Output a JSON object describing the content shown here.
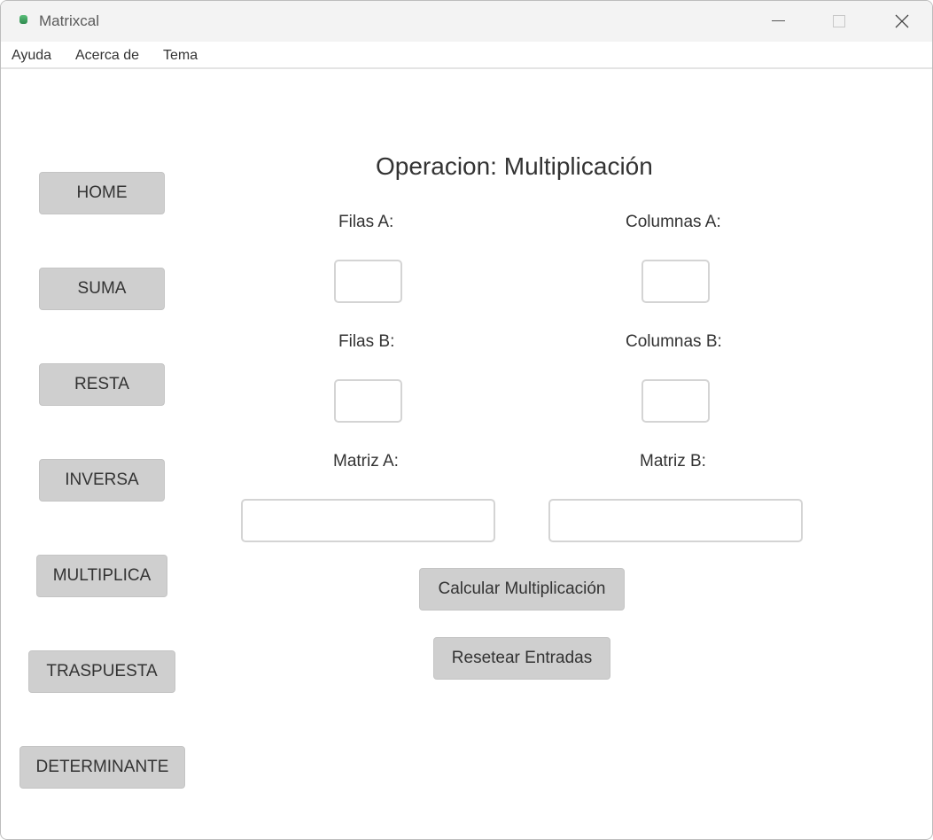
{
  "window": {
    "title": "Matrixcal"
  },
  "menu": {
    "items": [
      "Ayuda",
      "Acerca de",
      "Tema"
    ]
  },
  "sidebar": {
    "buttons": [
      "HOME",
      "SUMA",
      "RESTA",
      "INVERSA",
      "MULTIPLICA",
      "TRASPUESTA",
      "DETERMINANTE"
    ]
  },
  "main": {
    "heading": "Operacion: Multiplicación",
    "filas_a_label": "Filas A:",
    "columnas_a_label": "Columnas A:",
    "filas_b_label": "Filas B:",
    "columnas_b_label": "Columnas B:",
    "matriz_a_label": "Matriz A:",
    "matriz_b_label": "Matriz B:",
    "filas_a_value": "",
    "columnas_a_value": "",
    "filas_b_value": "",
    "columnas_b_value": "",
    "matriz_a_value": "",
    "matriz_b_value": "",
    "calcular_label": "Calcular Multiplicación",
    "resetear_label": "Resetear Entradas"
  },
  "colors": {
    "button_bg": "#cfcfcf",
    "titlebar_bg": "#f3f3f3",
    "text": "#333333"
  }
}
